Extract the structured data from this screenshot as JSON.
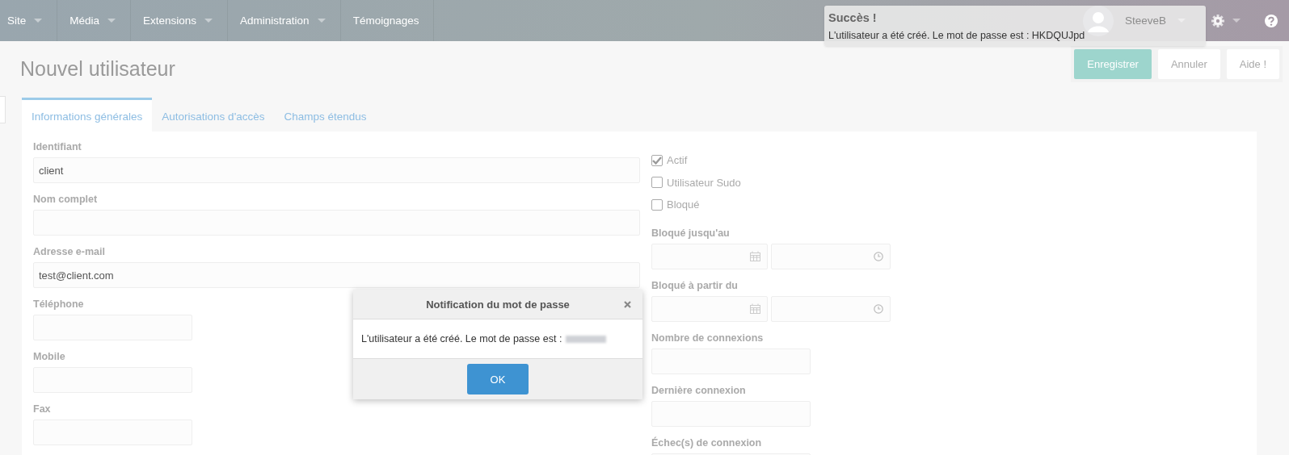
{
  "nav": {
    "items": [
      {
        "label": "Site",
        "has_menu": true
      },
      {
        "label": "Média",
        "has_menu": true
      },
      {
        "label": "Extensions",
        "has_menu": true
      },
      {
        "label": "Administration",
        "has_menu": true
      },
      {
        "label": "Témoignages",
        "has_menu": false
      }
    ],
    "user": "SteeveB"
  },
  "toast": {
    "title": "Succès !",
    "message": "L'utilisateur a été créé. Le mot de passe est : HKDQUJpd"
  },
  "page": {
    "title": "Nouvel utilisateur",
    "buttons": [
      {
        "label": "Enregistrer",
        "kind": "primary"
      },
      {
        "label": "Annuler",
        "kind": "default"
      },
      {
        "label": "Aide !",
        "kind": "default"
      }
    ]
  },
  "tabs": [
    {
      "label": "Informations générales",
      "selected": true
    },
    {
      "label": "Autorisations d'accès",
      "selected": false
    },
    {
      "label": "Champs étendus",
      "selected": false
    }
  ],
  "left_fields": [
    {
      "label": "Identifiant",
      "value": "client",
      "kind": "wide"
    },
    {
      "label": "Nom complet",
      "kind": "wide"
    },
    {
      "label": "Adresse e-mail",
      "value": "test@client.com",
      "kind": "wide"
    },
    {
      "label": "Téléphone",
      "kind": "short"
    },
    {
      "label": "Mobile",
      "kind": "short"
    },
    {
      "label": "Fax",
      "kind": "short"
    }
  ],
  "checkboxes": [
    {
      "label": "Actif",
      "checked": true
    },
    {
      "label": "Utilisateur Sudo",
      "checked": false
    },
    {
      "label": "Bloqué",
      "checked": false
    }
  ],
  "right_fields": [
    {
      "label": "Bloqué jusqu'au",
      "kind": "datetime"
    },
    {
      "label": "Bloqué à partir du",
      "kind": "datetime"
    },
    {
      "label": "Nombre de connexions",
      "kind": "short"
    },
    {
      "label": "Dernière connexion",
      "kind": "short"
    },
    {
      "label": "Échec(s) de connexion",
      "kind": "short"
    }
  ],
  "dialog": {
    "title": "Notification du mot de passe",
    "message": "L'utilisateur a été créé. Le mot de passe est :",
    "button": "OK"
  }
}
